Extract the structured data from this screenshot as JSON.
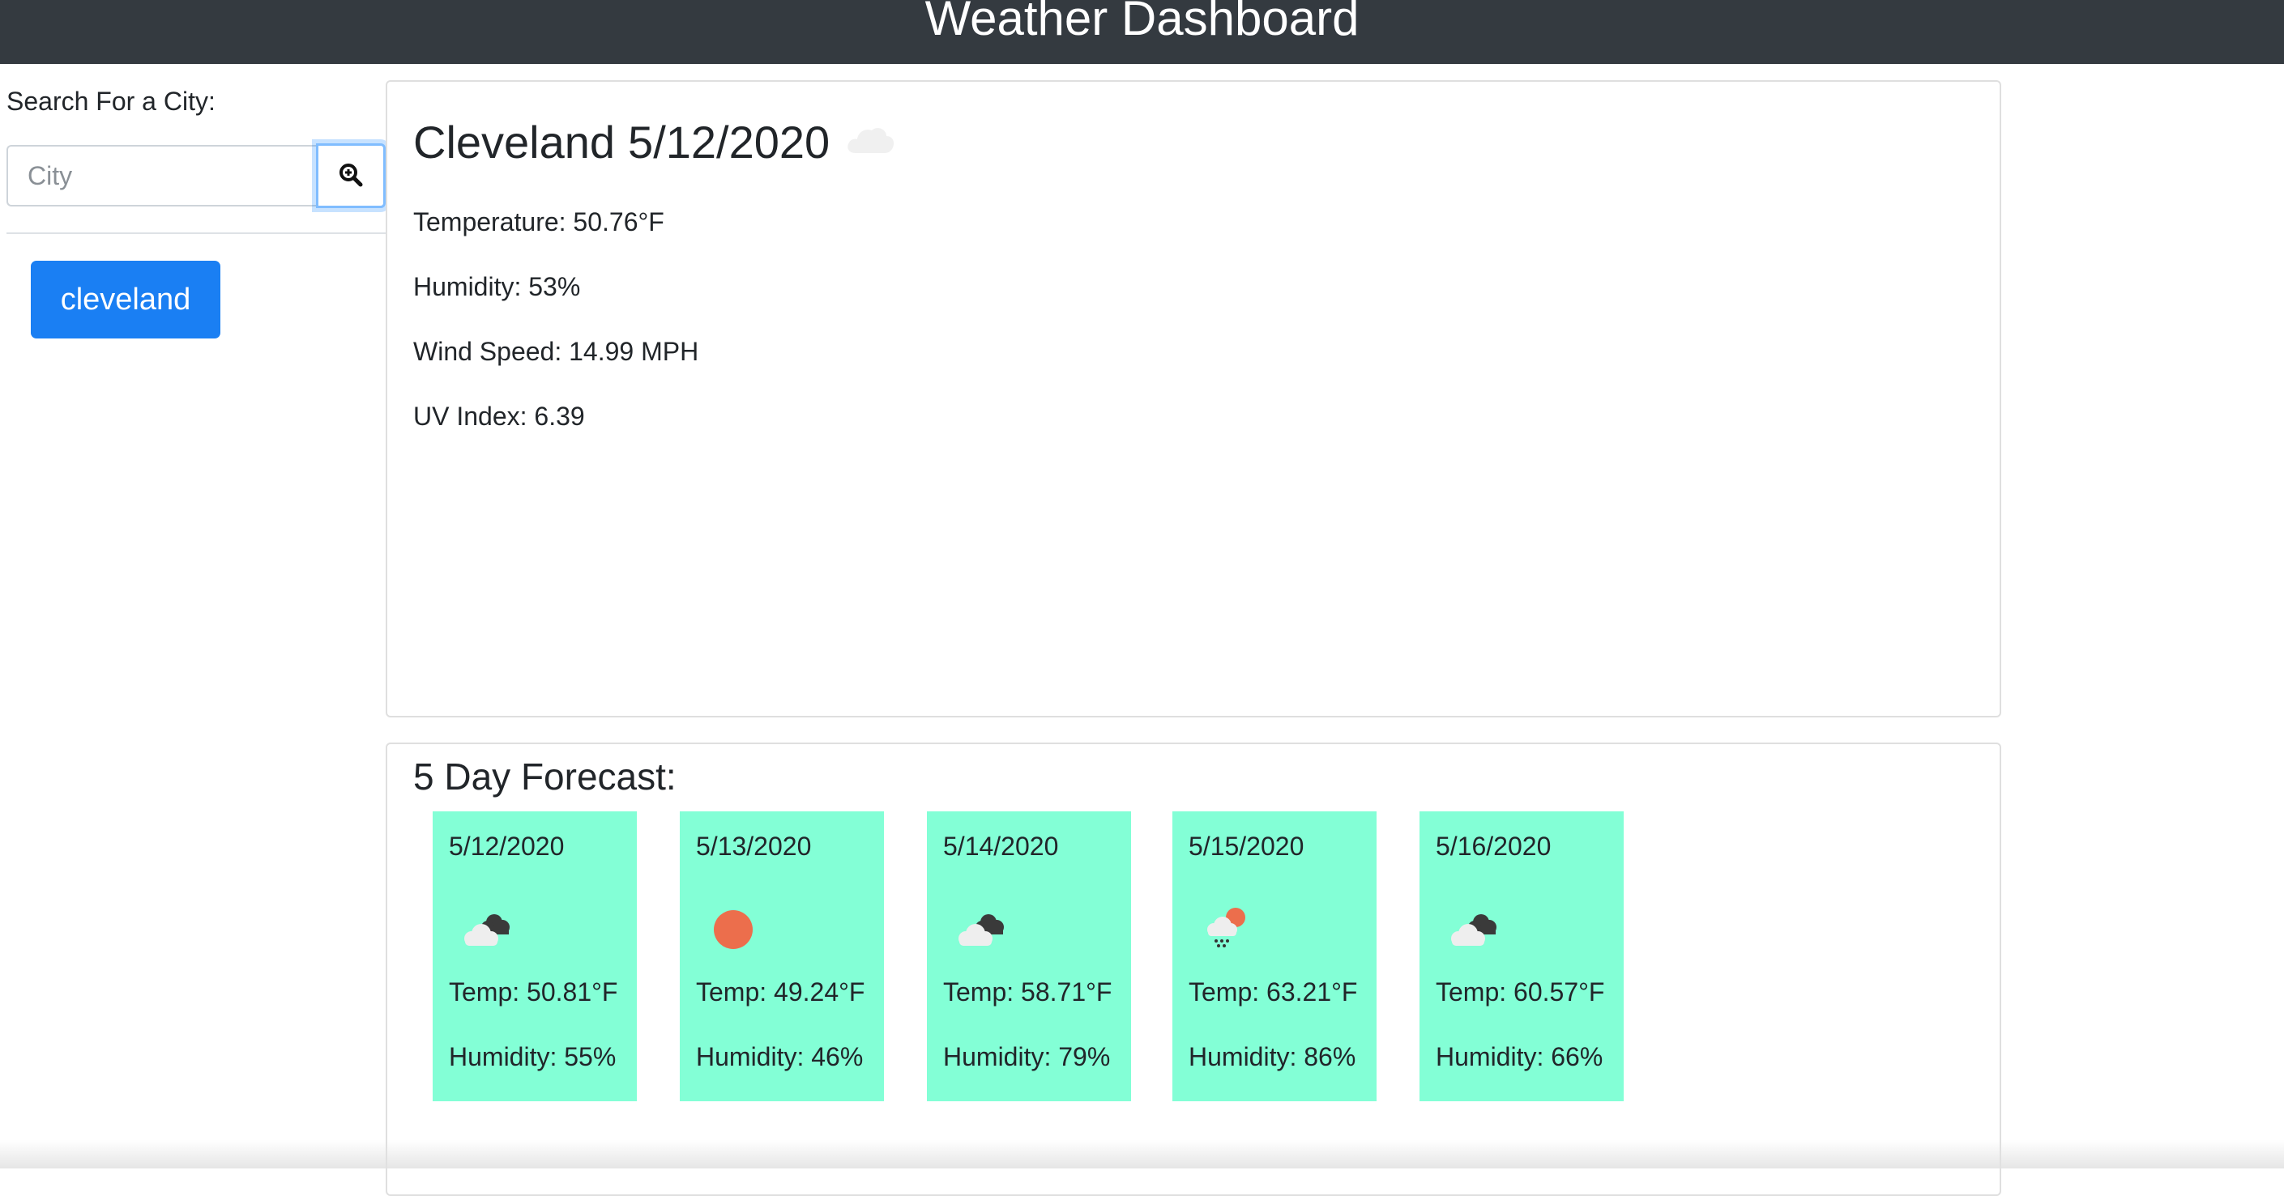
{
  "header": {
    "title": "Weather Dashboard"
  },
  "sidebar": {
    "search_label": "Search For a City:",
    "search_placeholder": "City",
    "search_icon": "zoom-in-icon",
    "history": [
      {
        "label": "cleveland"
      }
    ]
  },
  "current": {
    "city": "Cleveland",
    "date": "5/12/2020",
    "icon": "cloud-icon",
    "temperature": "Temperature: 50.76°F",
    "humidity": "Humidity: 53%",
    "wind_speed": "Wind Speed: 14.99 MPH",
    "uv_index": "UV Index: 6.39"
  },
  "forecast": {
    "title": "5 Day Forecast:",
    "days": [
      {
        "date": "5/12/2020",
        "icon": "broken-clouds-icon",
        "temp": "Temp: 50.81°F",
        "humidity": "Humidity: 55%"
      },
      {
        "date": "5/13/2020",
        "icon": "sun-icon",
        "temp": "Temp: 49.24°F",
        "humidity": "Humidity: 46%"
      },
      {
        "date": "5/14/2020",
        "icon": "broken-clouds-icon",
        "temp": "Temp: 58.71°F",
        "humidity": "Humidity: 79%"
      },
      {
        "date": "5/15/2020",
        "icon": "rain-sun-icon",
        "temp": "Temp: 63.21°F",
        "humidity": "Humidity: 86%"
      },
      {
        "date": "5/16/2020",
        "icon": "broken-clouds-icon",
        "temp": "Temp: 60.57°F",
        "humidity": "Humidity: 66%"
      }
    ]
  },
  "colors": {
    "navbar": "#343a40",
    "primary_button": "#1a7ff3",
    "forecast_card": "#83ffd6",
    "sun": "#ec6e4c"
  }
}
